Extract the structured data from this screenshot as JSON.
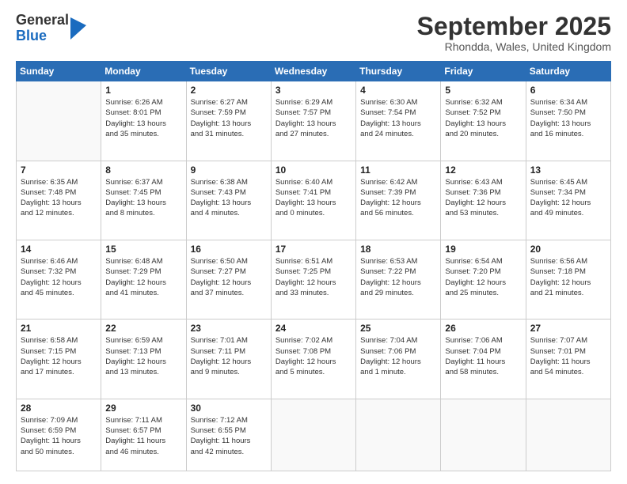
{
  "logo": {
    "general": "General",
    "blue": "Blue"
  },
  "title": "September 2025",
  "location": "Rhondda, Wales, United Kingdom",
  "weekdays": [
    "Sunday",
    "Monday",
    "Tuesday",
    "Wednesday",
    "Thursday",
    "Friday",
    "Saturday"
  ],
  "weeks": [
    [
      {
        "day": "",
        "info": ""
      },
      {
        "day": "1",
        "info": "Sunrise: 6:26 AM\nSunset: 8:01 PM\nDaylight: 13 hours\nand 35 minutes."
      },
      {
        "day": "2",
        "info": "Sunrise: 6:27 AM\nSunset: 7:59 PM\nDaylight: 13 hours\nand 31 minutes."
      },
      {
        "day": "3",
        "info": "Sunrise: 6:29 AM\nSunset: 7:57 PM\nDaylight: 13 hours\nand 27 minutes."
      },
      {
        "day": "4",
        "info": "Sunrise: 6:30 AM\nSunset: 7:54 PM\nDaylight: 13 hours\nand 24 minutes."
      },
      {
        "day": "5",
        "info": "Sunrise: 6:32 AM\nSunset: 7:52 PM\nDaylight: 13 hours\nand 20 minutes."
      },
      {
        "day": "6",
        "info": "Sunrise: 6:34 AM\nSunset: 7:50 PM\nDaylight: 13 hours\nand 16 minutes."
      }
    ],
    [
      {
        "day": "7",
        "info": "Sunrise: 6:35 AM\nSunset: 7:48 PM\nDaylight: 13 hours\nand 12 minutes."
      },
      {
        "day": "8",
        "info": "Sunrise: 6:37 AM\nSunset: 7:45 PM\nDaylight: 13 hours\nand 8 minutes."
      },
      {
        "day": "9",
        "info": "Sunrise: 6:38 AM\nSunset: 7:43 PM\nDaylight: 13 hours\nand 4 minutes."
      },
      {
        "day": "10",
        "info": "Sunrise: 6:40 AM\nSunset: 7:41 PM\nDaylight: 13 hours\nand 0 minutes."
      },
      {
        "day": "11",
        "info": "Sunrise: 6:42 AM\nSunset: 7:39 PM\nDaylight: 12 hours\nand 56 minutes."
      },
      {
        "day": "12",
        "info": "Sunrise: 6:43 AM\nSunset: 7:36 PM\nDaylight: 12 hours\nand 53 minutes."
      },
      {
        "day": "13",
        "info": "Sunrise: 6:45 AM\nSunset: 7:34 PM\nDaylight: 12 hours\nand 49 minutes."
      }
    ],
    [
      {
        "day": "14",
        "info": "Sunrise: 6:46 AM\nSunset: 7:32 PM\nDaylight: 12 hours\nand 45 minutes."
      },
      {
        "day": "15",
        "info": "Sunrise: 6:48 AM\nSunset: 7:29 PM\nDaylight: 12 hours\nand 41 minutes."
      },
      {
        "day": "16",
        "info": "Sunrise: 6:50 AM\nSunset: 7:27 PM\nDaylight: 12 hours\nand 37 minutes."
      },
      {
        "day": "17",
        "info": "Sunrise: 6:51 AM\nSunset: 7:25 PM\nDaylight: 12 hours\nand 33 minutes."
      },
      {
        "day": "18",
        "info": "Sunrise: 6:53 AM\nSunset: 7:22 PM\nDaylight: 12 hours\nand 29 minutes."
      },
      {
        "day": "19",
        "info": "Sunrise: 6:54 AM\nSunset: 7:20 PM\nDaylight: 12 hours\nand 25 minutes."
      },
      {
        "day": "20",
        "info": "Sunrise: 6:56 AM\nSunset: 7:18 PM\nDaylight: 12 hours\nand 21 minutes."
      }
    ],
    [
      {
        "day": "21",
        "info": "Sunrise: 6:58 AM\nSunset: 7:15 PM\nDaylight: 12 hours\nand 17 minutes."
      },
      {
        "day": "22",
        "info": "Sunrise: 6:59 AM\nSunset: 7:13 PM\nDaylight: 12 hours\nand 13 minutes."
      },
      {
        "day": "23",
        "info": "Sunrise: 7:01 AM\nSunset: 7:11 PM\nDaylight: 12 hours\nand 9 minutes."
      },
      {
        "day": "24",
        "info": "Sunrise: 7:02 AM\nSunset: 7:08 PM\nDaylight: 12 hours\nand 5 minutes."
      },
      {
        "day": "25",
        "info": "Sunrise: 7:04 AM\nSunset: 7:06 PM\nDaylight: 12 hours\nand 1 minute."
      },
      {
        "day": "26",
        "info": "Sunrise: 7:06 AM\nSunset: 7:04 PM\nDaylight: 11 hours\nand 58 minutes."
      },
      {
        "day": "27",
        "info": "Sunrise: 7:07 AM\nSunset: 7:01 PM\nDaylight: 11 hours\nand 54 minutes."
      }
    ],
    [
      {
        "day": "28",
        "info": "Sunrise: 7:09 AM\nSunset: 6:59 PM\nDaylight: 11 hours\nand 50 minutes."
      },
      {
        "day": "29",
        "info": "Sunrise: 7:11 AM\nSunset: 6:57 PM\nDaylight: 11 hours\nand 46 minutes."
      },
      {
        "day": "30",
        "info": "Sunrise: 7:12 AM\nSunset: 6:55 PM\nDaylight: 11 hours\nand 42 minutes."
      },
      {
        "day": "",
        "info": ""
      },
      {
        "day": "",
        "info": ""
      },
      {
        "day": "",
        "info": ""
      },
      {
        "day": "",
        "info": ""
      }
    ]
  ]
}
